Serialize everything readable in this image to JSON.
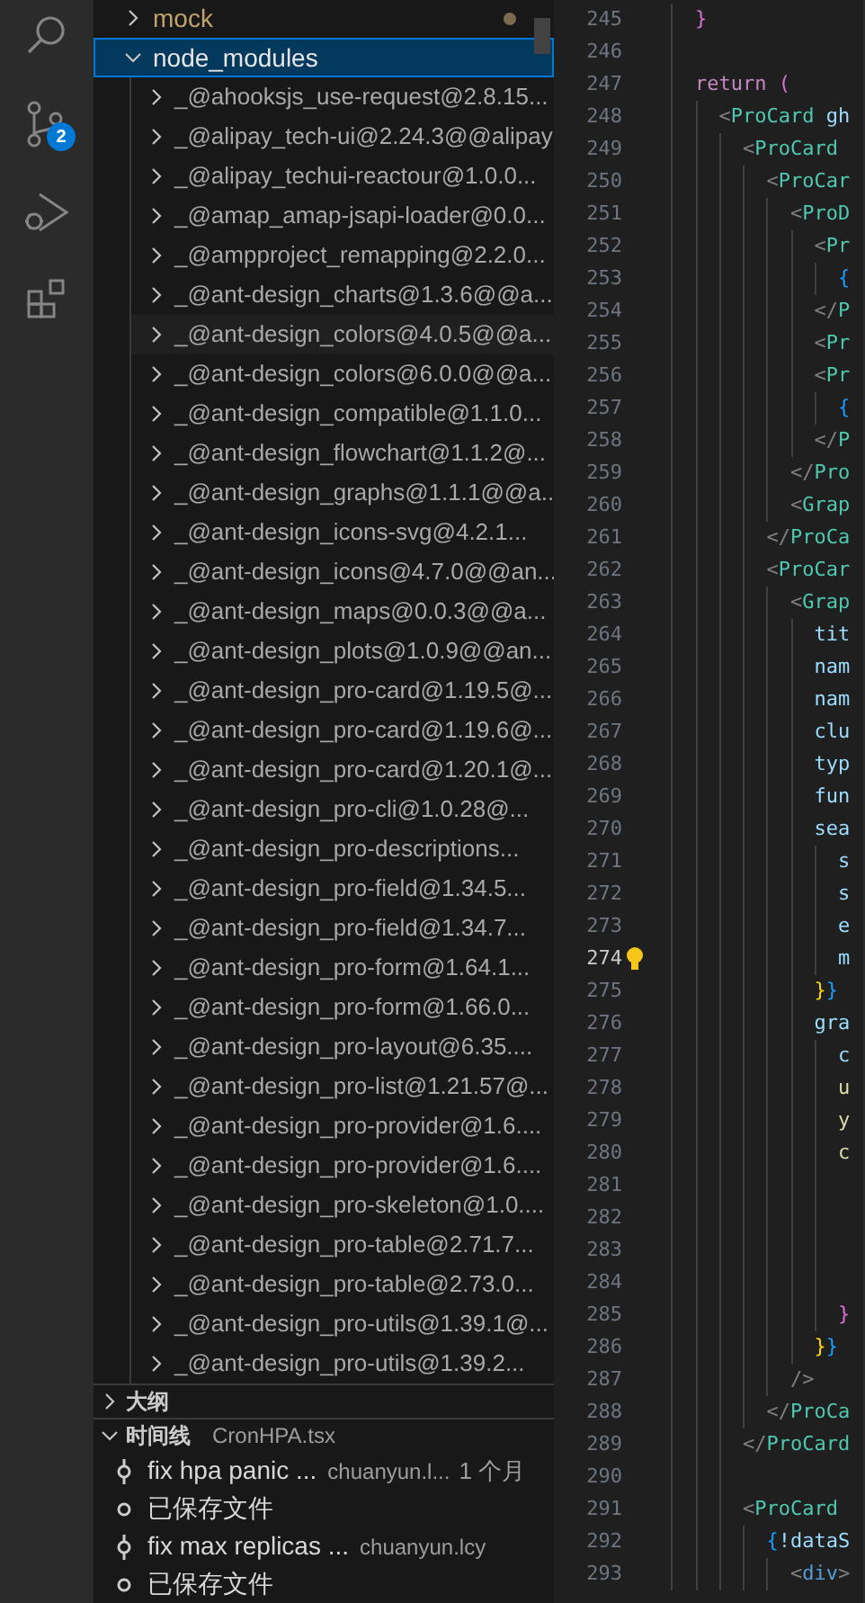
{
  "activity_bar": {
    "badge": "2"
  },
  "explorer": {
    "folders": [
      {
        "name": "mock",
        "expanded": false,
        "selected": false,
        "modified": true
      },
      {
        "name": "node_modules",
        "expanded": true,
        "selected": true,
        "modified": false,
        "children": [
          {
            "name": "_@ahooksjs_use-request@2.8.15...",
            "hovered": false
          },
          {
            "name": "_@alipay_tech-ui@2.24.3@@alipay",
            "hovered": false
          },
          {
            "name": "_@alipay_techui-reactour@1.0.0...",
            "hovered": false
          },
          {
            "name": "_@amap_amap-jsapi-loader@0.0...",
            "hovered": false
          },
          {
            "name": "_@ampproject_remapping@2.2.0...",
            "hovered": false
          },
          {
            "name": "_@ant-design_charts@1.3.6@@a...",
            "hovered": false
          },
          {
            "name": "_@ant-design_colors@4.0.5@@a...",
            "hovered": true
          },
          {
            "name": "_@ant-design_colors@6.0.0@@a...",
            "hovered": false
          },
          {
            "name": "_@ant-design_compatible@1.1.0...",
            "hovered": false
          },
          {
            "name": "_@ant-design_flowchart@1.1.2@...",
            "hovered": false
          },
          {
            "name": "_@ant-design_graphs@1.1.1@@a...",
            "hovered": false
          },
          {
            "name": "_@ant-design_icons-svg@4.2.1...",
            "hovered": false
          },
          {
            "name": "_@ant-design_icons@4.7.0@@an...",
            "hovered": false
          },
          {
            "name": "_@ant-design_maps@0.0.3@@a...",
            "hovered": false
          },
          {
            "name": "_@ant-design_plots@1.0.9@@an...",
            "hovered": false
          },
          {
            "name": "_@ant-design_pro-card@1.19.5@...",
            "hovered": false
          },
          {
            "name": "_@ant-design_pro-card@1.19.6@...",
            "hovered": false
          },
          {
            "name": "_@ant-design_pro-card@1.20.1@...",
            "hovered": false
          },
          {
            "name": "_@ant-design_pro-cli@1.0.28@...",
            "hovered": false
          },
          {
            "name": "_@ant-design_pro-descriptions...",
            "hovered": false
          },
          {
            "name": "_@ant-design_pro-field@1.34.5...",
            "hovered": false
          },
          {
            "name": "_@ant-design_pro-field@1.34.7...",
            "hovered": false
          },
          {
            "name": "_@ant-design_pro-form@1.64.1...",
            "hovered": false
          },
          {
            "name": "_@ant-design_pro-form@1.66.0...",
            "hovered": false
          },
          {
            "name": "_@ant-design_pro-layout@6.35....",
            "hovered": false
          },
          {
            "name": "_@ant-design_pro-list@1.21.57@...",
            "hovered": false
          },
          {
            "name": "_@ant-design_pro-provider@1.6....",
            "hovered": false
          },
          {
            "name": "_@ant-design_pro-provider@1.6....",
            "hovered": false
          },
          {
            "name": "_@ant-design_pro-skeleton@1.0....",
            "hovered": false
          },
          {
            "name": "_@ant-design_pro-table@2.71.7...",
            "hovered": false
          },
          {
            "name": "_@ant-design_pro-table@2.73.0...",
            "hovered": false
          },
          {
            "name": "_@ant-design_pro-utils@1.39.1@...",
            "hovered": false
          },
          {
            "name": "_@ant-design_pro-utils@1.39.2...",
            "hovered": false
          }
        ]
      }
    ]
  },
  "outline": {
    "title": "大纲",
    "expanded": false
  },
  "timeline": {
    "title": "时间线",
    "file": "CronHPA.tsx",
    "expanded": true,
    "entries": [
      {
        "kind": "commit",
        "title": "fix hpa panic ...",
        "author": "chuanyun.l...",
        "time": "1 个月"
      },
      {
        "kind": "save",
        "title": "已保存文件"
      },
      {
        "kind": "commit",
        "title": "fix max replicas ...",
        "author": "chuanyun.lcy"
      },
      {
        "kind": "save",
        "title": "已保存文件"
      }
    ]
  },
  "editor": {
    "lines": [
      {
        "number": "245",
        "current": false,
        "tokens": [
          {
            "text": "    }",
            "kind": "magenta"
          }
        ]
      },
      {
        "number": "246",
        "current": false
      },
      {
        "number": "247",
        "current": false,
        "tokens": [
          {
            "text": "    return",
            "kind": "keyword"
          },
          {
            "text": " (",
            "kind": "magenta"
          }
        ]
      },
      {
        "number": "248",
        "current": false,
        "tokens": [
          {
            "text": "      <",
            "kind": "punct"
          },
          {
            "text": "ProCard",
            "kind": "tag"
          },
          {
            "text": " gh",
            "kind": "attr"
          }
        ]
      },
      {
        "number": "249",
        "current": false,
        "tokens": [
          {
            "text": "        <",
            "kind": "punct"
          },
          {
            "text": "ProCard",
            "kind": "tag"
          }
        ]
      },
      {
        "number": "250",
        "current": false,
        "tokens": [
          {
            "text": "          <",
            "kind": "punct"
          },
          {
            "text": "ProCar",
            "kind": "tag"
          }
        ]
      },
      {
        "number": "251",
        "current": false,
        "tokens": [
          {
            "text": "            <",
            "kind": "punct"
          },
          {
            "text": "ProD",
            "kind": "tag"
          }
        ]
      },
      {
        "number": "252",
        "current": false,
        "tokens": [
          {
            "text": "              <",
            "kind": "punct"
          },
          {
            "text": "Pr",
            "kind": "tag"
          }
        ]
      },
      {
        "number": "253",
        "current": false,
        "tokens": [
          {
            "text": "                {",
            "kind": "blue"
          }
        ]
      },
      {
        "number": "254",
        "current": false,
        "tokens": [
          {
            "text": "              </",
            "kind": "punct"
          },
          {
            "text": "P",
            "kind": "tag"
          }
        ]
      },
      {
        "number": "255",
        "current": false,
        "tokens": [
          {
            "text": "              <",
            "kind": "punct"
          },
          {
            "text": "Pr",
            "kind": "tag"
          }
        ]
      },
      {
        "number": "256",
        "current": false,
        "tokens": [
          {
            "text": "              <",
            "kind": "punct"
          },
          {
            "text": "Pr",
            "kind": "tag"
          }
        ]
      },
      {
        "number": "257",
        "current": false,
        "tokens": [
          {
            "text": "                {",
            "kind": "blue"
          }
        ]
      },
      {
        "number": "258",
        "current": false,
        "tokens": [
          {
            "text": "              </",
            "kind": "punct"
          },
          {
            "text": "P",
            "kind": "tag"
          }
        ]
      },
      {
        "number": "259",
        "current": false,
        "tokens": [
          {
            "text": "            </",
            "kind": "punct"
          },
          {
            "text": "Pro",
            "kind": "tag"
          }
        ]
      },
      {
        "number": "260",
        "current": false,
        "tokens": [
          {
            "text": "            <",
            "kind": "punct"
          },
          {
            "text": "Grap",
            "kind": "tag"
          }
        ]
      },
      {
        "number": "261",
        "current": false,
        "tokens": [
          {
            "text": "          </",
            "kind": "punct"
          },
          {
            "text": "ProCa",
            "kind": "tag"
          }
        ]
      },
      {
        "number": "262",
        "current": false,
        "tokens": [
          {
            "text": "          <",
            "kind": "punct"
          },
          {
            "text": "ProCar",
            "kind": "tag"
          }
        ]
      },
      {
        "number": "263",
        "current": false,
        "tokens": [
          {
            "text": "            <",
            "kind": "punct"
          },
          {
            "text": "Grap",
            "kind": "tag"
          }
        ]
      },
      {
        "number": "264",
        "current": false,
        "tokens": [
          {
            "text": "              tit",
            "kind": "attr"
          }
        ]
      },
      {
        "number": "265",
        "current": false,
        "tokens": [
          {
            "text": "              nam",
            "kind": "attr"
          }
        ]
      },
      {
        "number": "266",
        "current": false,
        "tokens": [
          {
            "text": "              nam",
            "kind": "attr"
          }
        ]
      },
      {
        "number": "267",
        "current": false,
        "tokens": [
          {
            "text": "              clu",
            "kind": "attr"
          }
        ]
      },
      {
        "number": "268",
        "current": false,
        "tokens": [
          {
            "text": "              typ",
            "kind": "attr"
          }
        ]
      },
      {
        "number": "269",
        "current": false,
        "tokens": [
          {
            "text": "              fun",
            "kind": "attr"
          }
        ]
      },
      {
        "number": "270",
        "current": false,
        "tokens": [
          {
            "text": "              sea",
            "kind": "attr"
          }
        ]
      },
      {
        "number": "271",
        "current": false,
        "tokens": [
          {
            "text": "                s",
            "kind": "attr"
          }
        ]
      },
      {
        "number": "272",
        "current": false,
        "tokens": [
          {
            "text": "                s",
            "kind": "attr"
          }
        ]
      },
      {
        "number": "273",
        "current": false,
        "tokens": [
          {
            "text": "                e",
            "kind": "attr"
          }
        ]
      },
      {
        "number": "274",
        "current": true,
        "hint": true,
        "tokens": [
          {
            "text": "                m",
            "kind": "attr"
          }
        ]
      },
      {
        "number": "275",
        "current": false,
        "tokens": [
          {
            "text": "              }",
            "kind": "yellow"
          },
          {
            "text": "}",
            "kind": "blue"
          }
        ]
      },
      {
        "number": "276",
        "current": false,
        "tokens": [
          {
            "text": "              gra",
            "kind": "attr"
          }
        ]
      },
      {
        "number": "277",
        "current": false,
        "tokens": [
          {
            "text": "                c",
            "kind": "attr"
          }
        ]
      },
      {
        "number": "278",
        "current": false,
        "tokens": [
          {
            "text": "                u",
            "kind": "string"
          }
        ]
      },
      {
        "number": "279",
        "current": false,
        "tokens": [
          {
            "text": "                y",
            "kind": "string"
          }
        ]
      },
      {
        "number": "280",
        "current": false,
        "tokens": [
          {
            "text": "                c",
            "kind": "string"
          }
        ]
      },
      {
        "number": "281",
        "current": false
      },
      {
        "number": "282",
        "current": false
      },
      {
        "number": "283",
        "current": false
      },
      {
        "number": "284",
        "current": false
      },
      {
        "number": "285",
        "current": false,
        "tokens": [
          {
            "text": "                }",
            "kind": "magenta"
          }
        ]
      },
      {
        "number": "286",
        "current": false,
        "tokens": [
          {
            "text": "              }",
            "kind": "yellow"
          },
          {
            "text": "}",
            "kind": "blue"
          }
        ]
      },
      {
        "number": "287",
        "current": false,
        "tokens": [
          {
            "text": "            />",
            "kind": "punct"
          }
        ]
      },
      {
        "number": "288",
        "current": false,
        "tokens": [
          {
            "text": "          </",
            "kind": "punct"
          },
          {
            "text": "ProCa",
            "kind": "tag"
          }
        ]
      },
      {
        "number": "289",
        "current": false,
        "tokens": [
          {
            "text": "        </",
            "kind": "punct"
          },
          {
            "text": "ProCard",
            "kind": "tag"
          }
        ]
      },
      {
        "number": "290",
        "current": false
      },
      {
        "number": "291",
        "current": false,
        "tokens": [
          {
            "text": "        <",
            "kind": "punct"
          },
          {
            "text": "ProCard",
            "kind": "tag"
          }
        ]
      },
      {
        "number": "292",
        "current": false,
        "tokens": [
          {
            "text": "          {",
            "kind": "blue"
          },
          {
            "text": "!dataS",
            "kind": "attr"
          }
        ]
      },
      {
        "number": "293",
        "current": false,
        "tokens": [
          {
            "text": "            <",
            "kind": "punct"
          },
          {
            "text": "div",
            "kind": "keyword2"
          },
          {
            "text": ">",
            "kind": "punct"
          }
        ]
      }
    ]
  }
}
